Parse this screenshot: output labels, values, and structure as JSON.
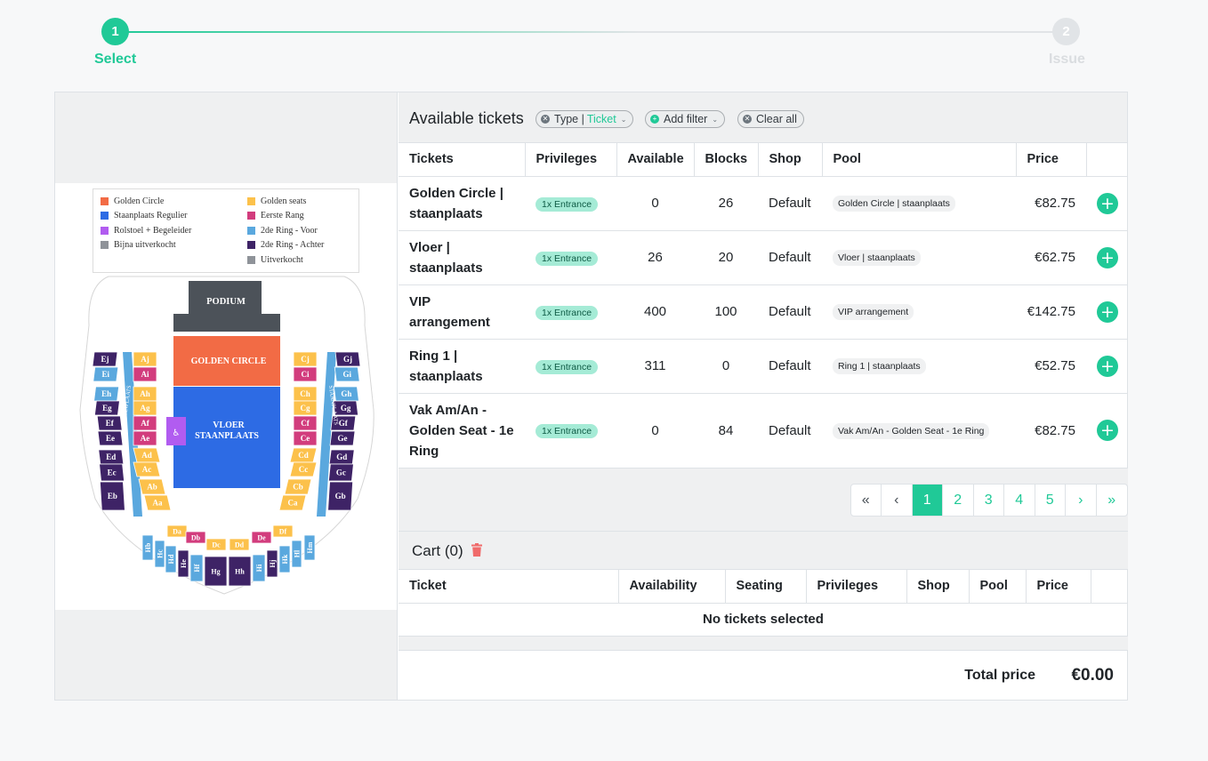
{
  "stepper": {
    "steps": [
      {
        "number": "1",
        "label": "Select",
        "state": "active"
      },
      {
        "number": "2",
        "label": "Issue",
        "state": "inactive"
      }
    ]
  },
  "colors": {
    "accent": "#20c997",
    "golden_circle": "#f26b45",
    "floor": "#2d6be4",
    "wheelchair": "#b15cf0",
    "almost_sold_out": "#8f9399",
    "golden_seats": "#fcc14b",
    "first_rank": "#d23c7d",
    "second_ring_front": "#5aa8de",
    "second_ring_back": "#3e2366",
    "sold_out": "#8f9399"
  },
  "venue_map": {
    "legend": [
      {
        "label": "Golden Circle",
        "color": "#f26b45"
      },
      {
        "label": "Staanplaats Regulier",
        "color": "#2d6be4"
      },
      {
        "label": "Rolstoel + Begeleider",
        "color": "#b15cf0"
      },
      {
        "label": "Bijna uitverkocht",
        "color": "#8f9399"
      },
      {
        "label": "Golden seats",
        "color": "#fcc14b"
      },
      {
        "label": "Eerste Rang",
        "color": "#d23c7d"
      },
      {
        "label": "2de Ring - Voor",
        "color": "#5aa8de"
      },
      {
        "label": "2de Ring - Achter",
        "color": "#3e2366"
      },
      {
        "label": "Uitverkocht",
        "color": "#8f9399"
      }
    ],
    "podium": "PODIUM",
    "golden_circle": "GOLDEN CIRCLE",
    "floor_line1": "VLOER",
    "floor_line2": "STAANPLAATS",
    "side_label": "STAANPLAATS",
    "wheelchair": "♿",
    "left_outer": [
      "Ej",
      "Ei",
      "Eh",
      "Eg",
      "Ef",
      "Ee",
      "Ed",
      "Ec",
      "Eb"
    ],
    "left_inner": [
      "Aj",
      "Ai",
      "Ah",
      "Ag",
      "Af",
      "Ae",
      "Ad",
      "Ac",
      "Ab",
      "Aa"
    ],
    "right_inner": [
      "Cj",
      "Ci",
      "Ch",
      "Cg",
      "Cf",
      "Ce",
      "Cd",
      "Cc",
      "Cb",
      "Ca"
    ],
    "right_outer": [
      "Gj",
      "Gi",
      "Gh",
      "Gg",
      "Gf",
      "Ge",
      "Gd",
      "Gc",
      "Gb"
    ],
    "front_row": [
      "Da",
      "Db",
      "Dc",
      "Dd",
      "De",
      "Df"
    ],
    "back_row": [
      "Hb",
      "Hc",
      "Hd",
      "He",
      "Hf",
      "Hg",
      "Hh",
      "Hi",
      "Hj",
      "Hk",
      "Hl",
      "Hm"
    ]
  },
  "filters": {
    "title": "Available tickets",
    "type_chip": {
      "prefix": "Type |",
      "value": "Ticket"
    },
    "add_filter": "Add filter",
    "clear_all": "Clear all"
  },
  "tickets_table": {
    "columns": [
      "Tickets",
      "Privileges",
      "Available",
      "Blocks",
      "Shop",
      "Pool",
      "Price",
      ""
    ],
    "rows": [
      {
        "name": "Golden Circle | staanplaats",
        "privilege": "1x Entrance",
        "available": "0",
        "blocks": "26",
        "shop": "Default",
        "pool": "Golden Circle | staanplaats",
        "price": "€82.75"
      },
      {
        "name": "Vloer | staanplaats",
        "privilege": "1x Entrance",
        "available": "26",
        "blocks": "20",
        "shop": "Default",
        "pool": "Vloer | staanplaats",
        "price": "€62.75"
      },
      {
        "name": "VIP arrangement",
        "privilege": "1x Entrance",
        "available": "400",
        "blocks": "100",
        "shop": "Default",
        "pool": "VIP arrangement",
        "price": "€142.75"
      },
      {
        "name": "Ring 1 | staanplaats",
        "privilege": "1x Entrance",
        "available": "311",
        "blocks": "0",
        "shop": "Default",
        "pool": "Ring 1 | staanplaats",
        "price": "€52.75"
      },
      {
        "name": "Vak Am/An - Golden Seat - 1e Ring",
        "privilege": "1x Entrance",
        "available": "0",
        "blocks": "84",
        "shop": "Default",
        "pool": "Vak Am/An - Golden Seat - 1e Ring",
        "price": "€82.75"
      }
    ],
    "add_label": "+"
  },
  "pagination": {
    "first": "«",
    "prev": "‹",
    "pages": [
      "1",
      "2",
      "3",
      "4",
      "5"
    ],
    "current": "1",
    "next": "›",
    "last": "»"
  },
  "cart": {
    "title": "Cart (0)",
    "columns": [
      "Ticket",
      "Availability",
      "Seating",
      "Privileges",
      "Shop",
      "Pool",
      "Price",
      ""
    ],
    "empty_message": "No tickets selected",
    "total_label": "Total price",
    "total_value": "€0.00"
  }
}
